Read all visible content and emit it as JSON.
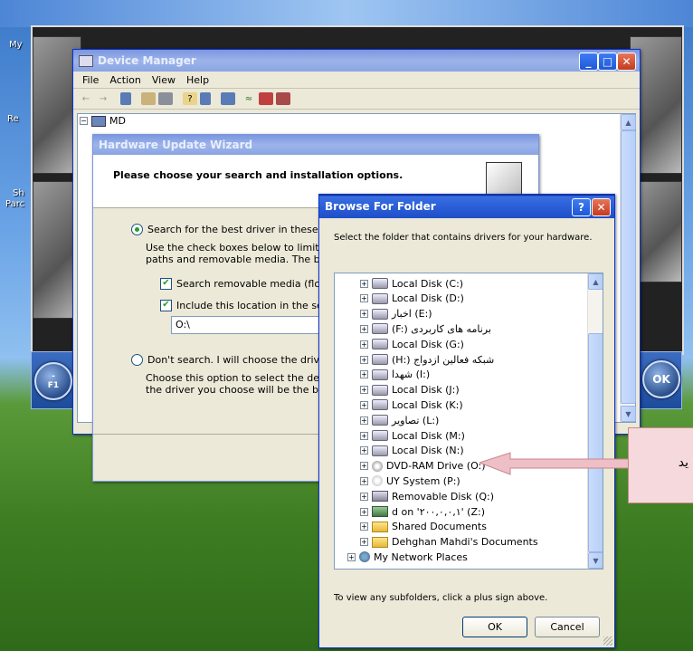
{
  "desktop": {
    "icon_labels": [
      "My",
      "Re",
      "Sh",
      "Parc"
    ],
    "left_btn_line1": "-",
    "left_btn_line2": "F1",
    "ok_button": "OK"
  },
  "device_manager": {
    "title": "Device Manager",
    "menu": [
      "File",
      "Action",
      "View",
      "Help"
    ],
    "tree_root": "MD"
  },
  "wizard": {
    "title": "Hardware Update Wizard",
    "heading": "Please choose your search and installation options.",
    "opt1_label": "Search for the best driver in these locatio",
    "opt1_desc_line1": "Use the check boxes below to limit or exp",
    "opt1_desc_line2": "paths and removable media. The best driv",
    "check1_label": "Search removable media (floppy, C",
    "check2_label": "Include this location in the search:",
    "path_value": "O:\\",
    "opt2_label": "Don't search. I will choose the driver to in",
    "opt2_desc_line1": "Choose this option to select the device dr",
    "opt2_desc_line2": "the driver you choose will be the best mat"
  },
  "browse": {
    "title": "Browse For Folder",
    "instruction": "Select the folder that contains drivers for your hardware.",
    "folders": [
      {
        "label": "Local Disk (C:)",
        "icon": "drive-icon"
      },
      {
        "label": "Local Disk (D:)",
        "icon": "drive-icon"
      },
      {
        "label": "اخبار (E:)",
        "icon": "drive-icon"
      },
      {
        "label": "(F:) برنامه های کاربردی",
        "icon": "drive-icon"
      },
      {
        "label": "Local Disk (G:)",
        "icon": "drive-icon"
      },
      {
        "label": "(H:) شبکه فعالین ازدواج",
        "icon": "drive-icon"
      },
      {
        "label": "شهدا (I:)",
        "icon": "drive-icon"
      },
      {
        "label": "Local Disk (J:)",
        "icon": "drive-icon"
      },
      {
        "label": "Local Disk (K:)",
        "icon": "drive-icon"
      },
      {
        "label": "تصاویر (L:)",
        "icon": "drive-icon"
      },
      {
        "label": "Local Disk (M:)",
        "icon": "drive-icon"
      },
      {
        "label": "Local Disk (N:)",
        "icon": "drive-icon"
      },
      {
        "label": "DVD-RAM Drive (O:)",
        "icon": "dvd-drive-icon"
      },
      {
        "label": "UY System (P:)",
        "icon": "cd-drive-icon"
      },
      {
        "label": "Removable Disk (Q:)",
        "icon": "removable-disk-icon"
      },
      {
        "label": "d on '۲۰۰,۰,۰,۱' (Z:)",
        "icon": "network-drive-icon"
      },
      {
        "label": "Shared Documents",
        "icon": "folder-icon"
      },
      {
        "label": "Dehghan Mahdi's Documents",
        "icon": "folder-icon"
      }
    ],
    "network_places": "My Network Places",
    "footer_hint": "To view any subfolders, click a plus sign above.",
    "ok_label": "OK",
    "cancel_label": "Cancel"
  },
  "callout": {
    "text": "ید"
  },
  "colors": {
    "titlebar": "#2a5fd8",
    "callout_fill": "#f6d9dd",
    "arrow": "#d88"
  }
}
